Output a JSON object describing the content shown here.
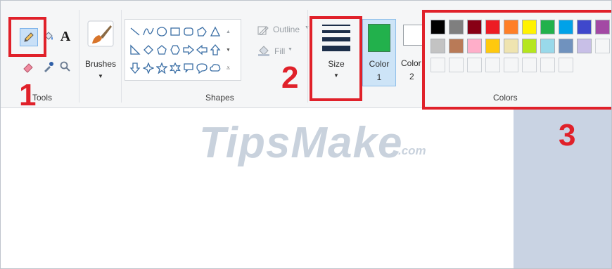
{
  "tools_group": {
    "label": "Tools"
  },
  "brushes": {
    "label": "Brushes"
  },
  "shapes_group": {
    "label": "Shapes",
    "outline_label": "Outline",
    "fill_label": "Fill"
  },
  "size": {
    "label": "Size"
  },
  "color1": {
    "label": "Color",
    "number": "1",
    "value": "#22b14c"
  },
  "color2": {
    "label": "Color",
    "number": "2",
    "value": "#ffffff"
  },
  "colors_group": {
    "label": "Colors"
  },
  "palette": {
    "row1": [
      "#000000",
      "#7f7f7f",
      "#880015",
      "#ed1c24",
      "#ff7f27",
      "#fff200",
      "#22b14c",
      "#00a2e8",
      "#3f48cc",
      "#a349a4"
    ],
    "row2": [
      "#ffffff",
      "#c3c3c3",
      "#b97a57",
      "#ffaec9",
      "#ffc90e",
      "#efe4b0",
      "#b5e61d",
      "#99d9ea",
      "#7092be",
      "#c8bfe7"
    ]
  },
  "annotations": {
    "step1": "1",
    "step2": "2",
    "step3": "3"
  },
  "watermark": {
    "text": "TipsMake",
    "suffix": ".com"
  }
}
